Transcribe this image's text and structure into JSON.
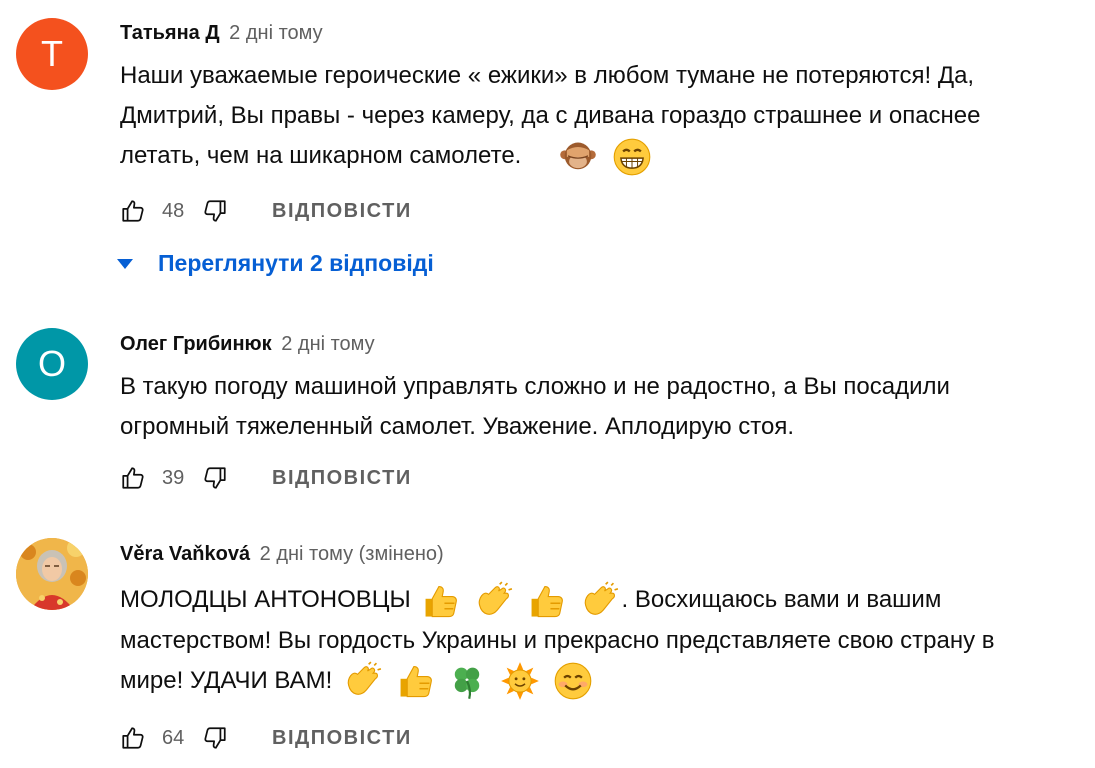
{
  "comments": [
    {
      "avatar_letter": "T",
      "avatar_color": "#f4511e",
      "author": "Татьяна Д",
      "time": "2 дні тому",
      "text_lines": [
        "Наши уважаемые героические « ежики» в любом тумане не потеряются! Да,",
        "Дмитрий, Вы правы - через камеру,  да с дивана гораздо страшнее и опаснее",
        "летать, чем на шикарном самолете."
      ],
      "line3_emojis": [
        "see-no-evil-monkey-emoji",
        "grinning-face-emoji"
      ],
      "likes": "48",
      "reply_label": "ВІДПОВІСТИ",
      "view_replies": "Переглянути 2 відповіді"
    },
    {
      "avatar_letter": "О",
      "avatar_color": "#0097a7",
      "author": "Олег Грибинюк",
      "time": "2 дні тому",
      "text_lines": [
        "В такую погоду машиной управлять сложно и не радостно, а  Вы посадили",
        "огромный тяжеленный самолет. Уважение. Аплодирую стоя."
      ],
      "likes": "39",
      "reply_label": "ВІДПОВІСТИ"
    },
    {
      "author": "Věra Vaňková",
      "time": "2 дні тому (змінено)",
      "text_line1_start": "МОЛОДЦЫ АНТОНОВЦЫ",
      "text_line1_end": ". Восхищаюсь вами и вашим",
      "text_line2": "мастерством! Вы гордость Украины и прекрасно представляете свою страну в",
      "text_line3": "мире! УДАЧИ ВАМ!",
      "likes": "64",
      "reply_label": "ВІДПОВІСТИ"
    }
  ],
  "colors": {
    "link_blue": "#065fd4",
    "secondary_text": "#606060"
  }
}
